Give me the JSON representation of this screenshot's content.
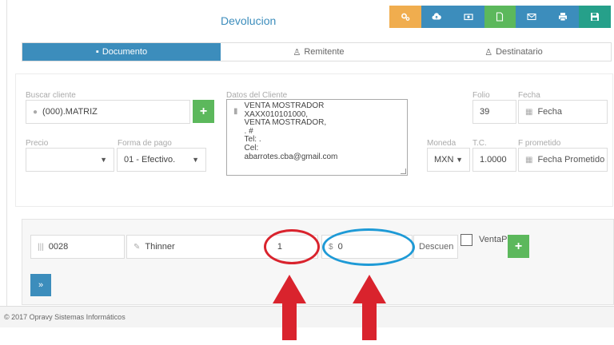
{
  "header": {
    "title": "Devolucion"
  },
  "toolbar": {
    "buttons": [
      {
        "name": "settings",
        "color": "#f0ad4e"
      },
      {
        "name": "cloud-upload",
        "color": "#3c8dbc"
      },
      {
        "name": "money",
        "color": "#3c8dbc"
      },
      {
        "name": "document",
        "color": "#5cb85c"
      },
      {
        "name": "email",
        "color": "#3c8dbc"
      },
      {
        "name": "print",
        "color": "#3c8dbc"
      },
      {
        "name": "save",
        "color": "#26a08a"
      }
    ]
  },
  "tabs": [
    {
      "label": "Documento",
      "icon": "file-icon",
      "active": true
    },
    {
      "label": "Remitente",
      "icon": "user-icon",
      "active": false
    },
    {
      "label": "Destinatario",
      "icon": "user-icon",
      "active": false
    }
  ],
  "form": {
    "buscar_cliente": {
      "label": "Buscar cliente",
      "value": "(000).MATRIZ"
    },
    "datos_cliente": {
      "label": "Datos del Cliente",
      "lines": [
        "VENTA MOSTRADOR",
        "XAXX010101000,",
        "VENTA MOSTRADOR,",
        ". #",
        "Tel: .",
        "Cel:",
        "abarrotes.cba@gmail.com"
      ]
    },
    "folio": {
      "label": "Folio",
      "value": "39"
    },
    "fecha": {
      "label": "Fecha",
      "placeholder": "Fecha"
    },
    "precio": {
      "label": "Precio",
      "value": ""
    },
    "forma_pago": {
      "label": "Forma de pago",
      "value": "01 - Efectivo."
    },
    "moneda": {
      "label": "Moneda",
      "value": "MXN"
    },
    "tc": {
      "label": "T.C.",
      "value": "1.0000"
    },
    "f_prometido": {
      "label": "F prometido",
      "placeholder": "Fecha Prometido"
    }
  },
  "line_item": {
    "code": "0028",
    "description": "Thinner",
    "quantity": "1",
    "price_symbol": "$",
    "price": "0",
    "discount_placeholder": "Descuen",
    "checkbox_label": "VentaPo",
    "add_symbol": "+",
    "next_symbol": "»"
  },
  "footer": {
    "text": "© 2017 Opravy Sistemas Informáticos"
  },
  "annotations": {
    "red": "#d9232d",
    "blue": "#1e9ad6"
  }
}
